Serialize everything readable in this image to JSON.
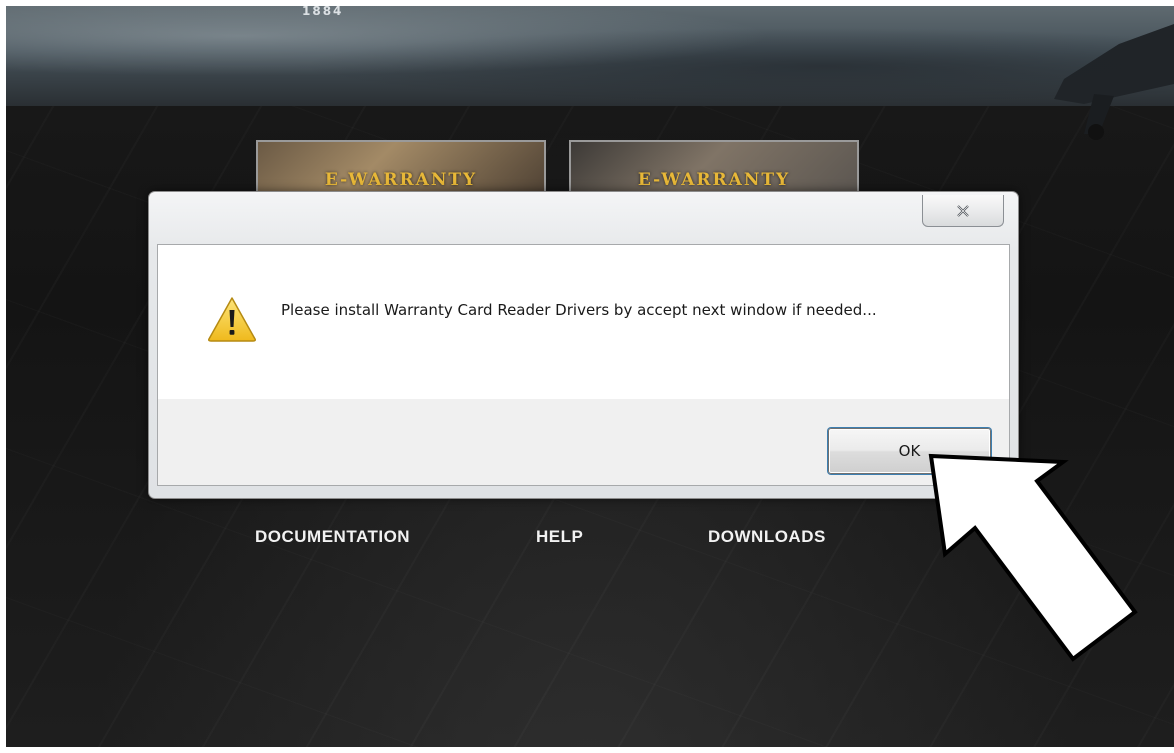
{
  "background": {
    "banner_text": "1884",
    "tiles": [
      {
        "label": "E-WARRANTY"
      },
      {
        "label": "E-WARRANTY"
      }
    ],
    "nav": {
      "documentation": "DOCUMENTATION",
      "help": "HELP",
      "downloads": "DOWNLOADS"
    }
  },
  "dialog": {
    "close_icon": "close-x-icon",
    "icon": "warning-icon",
    "message": "Please install Warranty Card Reader Drivers by accept next window if needed...",
    "ok_label": "OK"
  },
  "annotation": {
    "arrow_icon": "white-pointer-arrow",
    "arrow_color": "#ffffff"
  },
  "colors": {
    "tile_text": "#e8b838",
    "nav_text": "#f2f2f2",
    "focus_ring": "#3c7fb1",
    "warning_yellow": "#f7d033"
  }
}
